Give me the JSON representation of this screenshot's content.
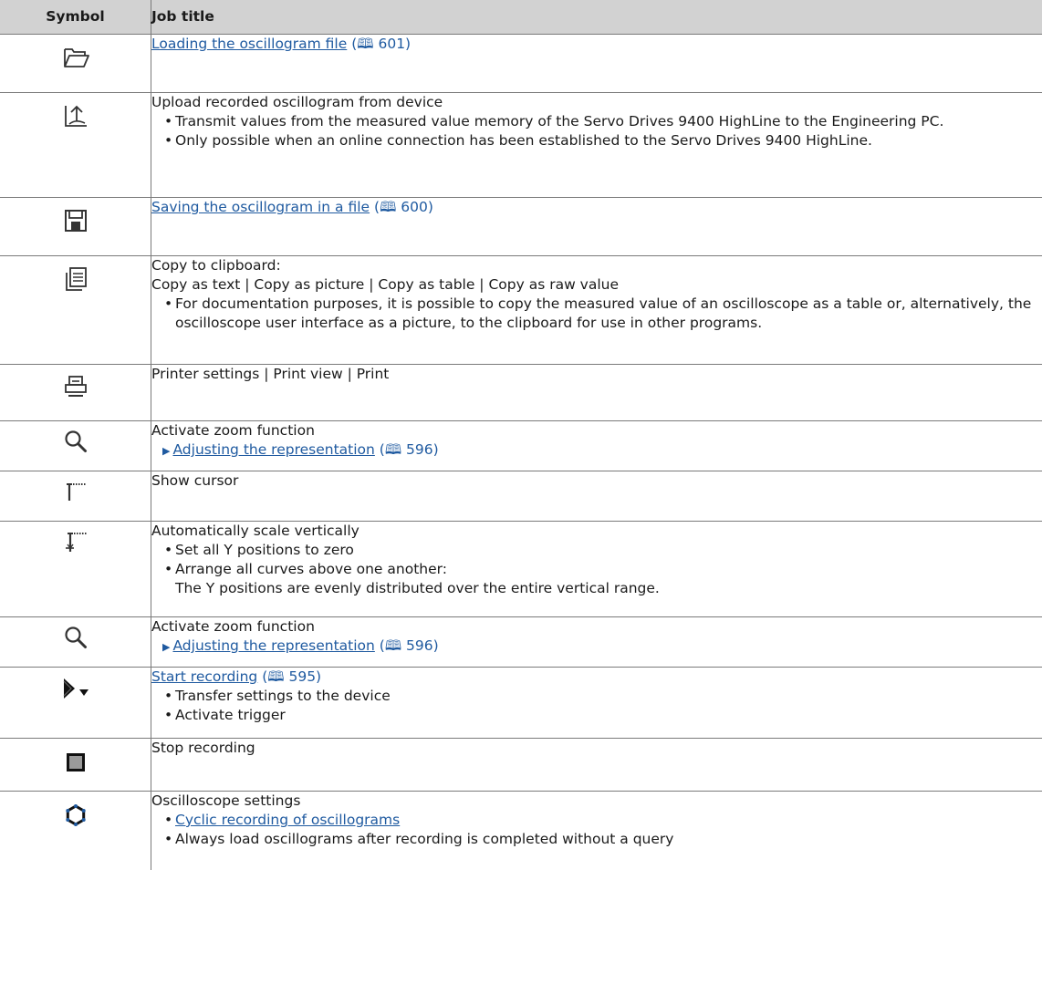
{
  "header": {
    "symbol": "Symbol",
    "job_title": "Job title"
  },
  "rows": [
    {
      "link": "Loading the oscillogram file",
      "ref": "(🕮 601)"
    },
    {
      "title": "Upload recorded oscillogram from device",
      "bullets": [
        "Transmit values from the measured value memory of the Servo Drives 9400 HighLine to the Engineering PC.",
        "Only possible when an online connection has been established to the Servo Drives 9400 HighLine."
      ]
    },
    {
      "link": "Saving the oscillogram in a file",
      "ref": "(🕮 600)"
    },
    {
      "title": "Copy to clipboard:",
      "line2": "Copy as text | Copy as picture | Copy as table | Copy as raw value",
      "bullets": [
        "For documentation purposes, it is possible to copy the measured value of an oscilloscope as a table or, alternatively, the oscilloscope user interface as a picture, to the clipboard for use in other programs."
      ]
    },
    {
      "title": "Printer settings | Print view | Print"
    },
    {
      "title": "Activate zoom function",
      "link": "Adjusting the representation",
      "ref": "(🕮 596)"
    },
    {
      "title": "Show cursor"
    },
    {
      "title": "Automatically scale vertically",
      "bullets": [
        "Set all Y positions to zero",
        "Arrange all curves above one another:"
      ],
      "sub": "The Y positions are evenly distributed over the entire vertical range."
    },
    {
      "title": "Activate zoom function",
      "link": "Adjusting the representation",
      "ref": "(🕮 596)"
    },
    {
      "link": "Start recording",
      "ref": " (🕮 595)",
      "bullets": [
        "Transfer settings to the device",
        "Activate trigger"
      ]
    },
    {
      "title": "Stop recording"
    },
    {
      "title": "Oscilloscope settings",
      "link": "Cyclic recording of oscillograms",
      "bullets": [
        "Always load oscillograms after recording is completed without a query"
      ]
    }
  ],
  "icons": [
    "folder-open-icon",
    "upload-icon",
    "save-icon",
    "copy-icon",
    "printer-icon",
    "magnifier-icon",
    "cursor-icon",
    "auto-scale-icon",
    "magnifier-icon",
    "start-recording-icon",
    "stop-icon",
    "settings-icon"
  ],
  "colors": {
    "header_bg": "#d2d2d2",
    "link": "#1f5aa0",
    "border": "#7a7a7a"
  }
}
